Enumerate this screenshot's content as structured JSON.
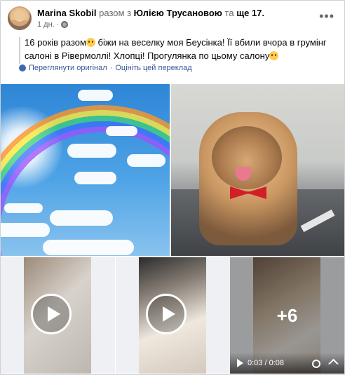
{
  "post": {
    "author": "Marina Skobil",
    "with_text": "разом з",
    "tagged": "Юлією Трусановою",
    "and_text": "та",
    "more_people": "ще 17.",
    "time": "1 дн.",
    "privacy_icon": "globe-icon",
    "menu_icon": "more-horizontal-icon",
    "text_part1": "16 років разом",
    "text_part2": " біжи на веселку моя Беусінка! Її вбили вчора в грумінг салоні в Рівермоллі! Хлопці! Прогулянка по цьому салону",
    "translate_links": {
      "show_original": "Переглянути оригінал",
      "separator": "·",
      "rate": "Оцініть цей переклад"
    }
  },
  "media": {
    "more_count": "+6",
    "video_time": "0:03 / 0:08"
  },
  "colors": {
    "link": "#385898",
    "text": "#050505",
    "meta": "#65676b"
  }
}
